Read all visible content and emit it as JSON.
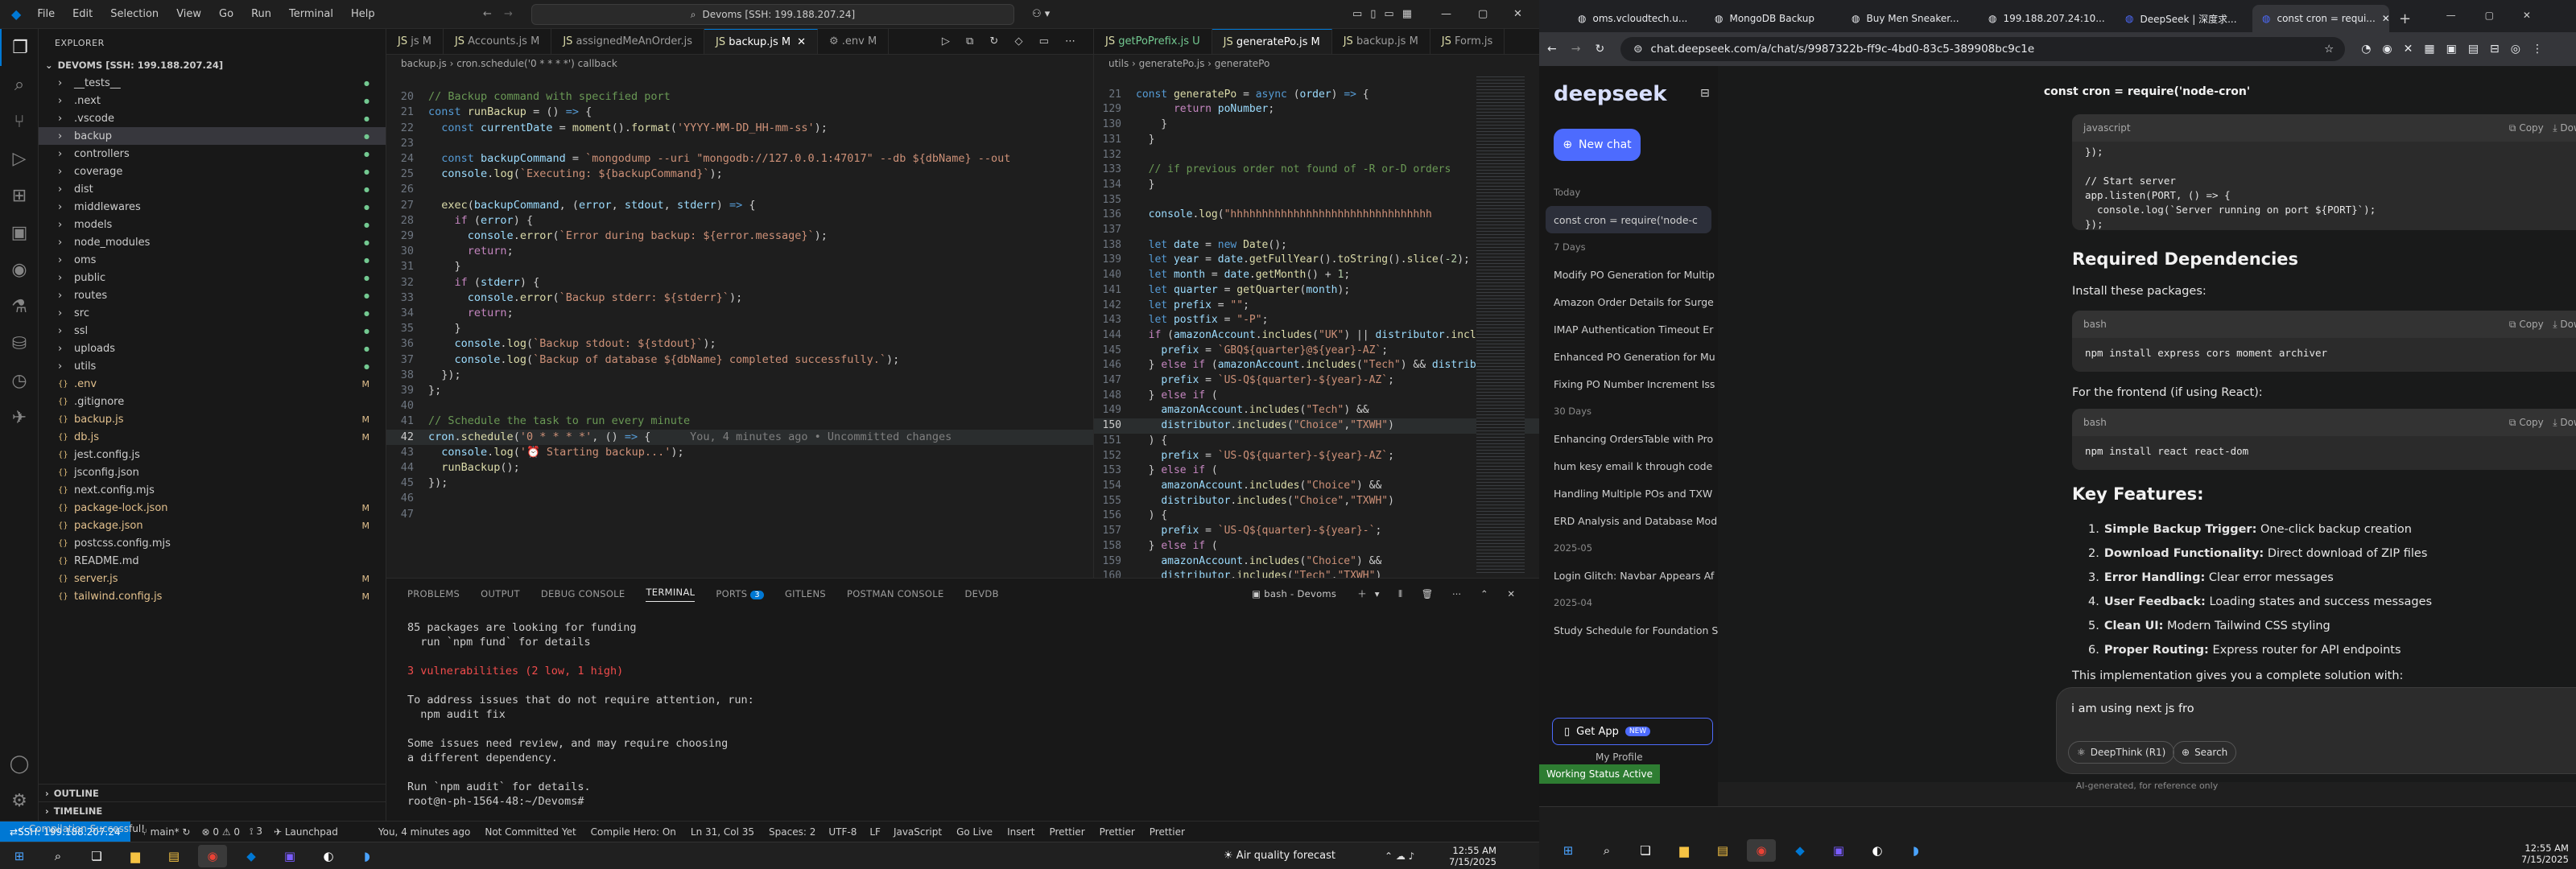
{
  "vscode": {
    "title": "Devoms [SSH: 199.188.207.24]",
    "menus": [
      "File",
      "Edit",
      "Selection",
      "View",
      "Go",
      "Run",
      "Terminal",
      "Help"
    ],
    "explorer": {
      "title": "EXPLORER",
      "root": "DEVOMS [SSH: 199.188.207.24]",
      "items": [
        {
          "name": "__tests__",
          "type": "folder",
          "badge": ""
        },
        {
          "name": ".next",
          "type": "folder",
          "badge": ""
        },
        {
          "name": ".vscode",
          "type": "folder",
          "badge": ""
        },
        {
          "name": "backup",
          "type": "folder",
          "badge": "",
          "selected": true
        },
        {
          "name": "controllers",
          "type": "folder",
          "badge": ""
        },
        {
          "name": "coverage",
          "type": "folder",
          "badge": ""
        },
        {
          "name": "dist",
          "type": "folder",
          "badge": ""
        },
        {
          "name": "middlewares",
          "type": "folder",
          "badge": ""
        },
        {
          "name": "models",
          "type": "folder",
          "badge": ""
        },
        {
          "name": "node_modules",
          "type": "folder",
          "badge": ""
        },
        {
          "name": "oms",
          "type": "folder",
          "badge": ""
        },
        {
          "name": "public",
          "type": "folder",
          "badge": ""
        },
        {
          "name": "routes",
          "type": "folder",
          "badge": ""
        },
        {
          "name": "src",
          "type": "folder",
          "badge": ""
        },
        {
          "name": "ssl",
          "type": "folder",
          "badge": ""
        },
        {
          "name": "uploads",
          "type": "folder",
          "badge": ""
        },
        {
          "name": "utils",
          "type": "folder",
          "badge": ""
        },
        {
          "name": ".env",
          "type": "file",
          "badge": "M"
        },
        {
          "name": ".gitignore",
          "type": "file",
          "badge": ""
        },
        {
          "name": "backup.js",
          "type": "file",
          "badge": "M"
        },
        {
          "name": "db.js",
          "type": "file",
          "badge": "M"
        },
        {
          "name": "jest.config.js",
          "type": "file",
          "badge": ""
        },
        {
          "name": "jsconfig.json",
          "type": "file",
          "badge": ""
        },
        {
          "name": "next.config.mjs",
          "type": "file",
          "badge": ""
        },
        {
          "name": "package-lock.json",
          "type": "file",
          "badge": "M"
        },
        {
          "name": "package.json",
          "type": "file",
          "badge": "M"
        },
        {
          "name": "postcss.config.mjs",
          "type": "file",
          "badge": ""
        },
        {
          "name": "README.md",
          "type": "file",
          "badge": ""
        },
        {
          "name": "server.js",
          "type": "file",
          "badge": "M"
        },
        {
          "name": "tailwind.config.js",
          "type": "file",
          "badge": "M"
        }
      ],
      "outline": "OUTLINE",
      "timeline": "TIMELINE"
    },
    "tabs_left": [
      "js M",
      "Accounts.js M",
      "assignedMeAnOrder.js",
      "backup.js M",
      ".env M"
    ],
    "tabs_right": [
      "getPoPrefix.js U",
      "generatePo.js M",
      "backup.js M",
      "Form.js"
    ],
    "breadcrumb_left": "backup.js › cron.schedule('0 * * * *') callback",
    "breadcrumb_right": "utils › generatePo.js › generatePo",
    "blame": "You, 4 minutes ago • Uncommitted changes",
    "panel_tabs": [
      "PROBLEMS",
      "OUTPUT",
      "DEBUG CONSOLE",
      "TERMINAL",
      "PORTS",
      "GITLENS",
      "POSTMAN CONSOLE",
      "DEVDB"
    ],
    "ports_badge": "3",
    "terminal_name": "bash - Devoms",
    "terminal_lines": [
      "85 packages are looking for funding",
      "  run `npm fund` for details",
      "",
      "3 vulnerabilities (2 low, 1 high)",
      "",
      "To address issues that do not require attention, run:",
      "  npm audit fix",
      "",
      "Some issues need review, and may require choosing",
      "a different dependency.",
      "",
      "Run `npm audit` for details.",
      "root@n-ph-1564-48:~/Devoms# "
    ],
    "status": {
      "remote": "SSH: 199.188.207.24",
      "branch": "main*",
      "errors": "0",
      "warnings": "0",
      "ports": "3",
      "launchpad": "Launchpad",
      "blame": "You, 4 minutes ago",
      "notcommitted": "Not Committed Yet",
      "compile": "Compile Hero: On",
      "position": "Ln 31, Col 35",
      "spaces": "Spaces: 2",
      "encoding": "UTF-8",
      "eol": "LF",
      "lang": "JavaScript",
      "golive": "Go Live",
      "insert": "Insert",
      "prettier": "Prettier",
      "message": "Compilation Successful!"
    }
  },
  "taskbar": {
    "weather": "Air quality forecast",
    "time": "12:55 AM",
    "date": "7/15/2025"
  },
  "browser": {
    "tabs": [
      "oms.vcloudtech.u...",
      "MongoDB Backup",
      "Buy Men Sneaker...",
      "199.188.207.24:10...",
      "DeepSeek | 深度求...",
      "const cron = requi..."
    ],
    "url": "chat.deepseek.com/a/chat/s/9987322b-ff9c-4bd0-83c5-389908bc9c1e",
    "page_title": "const cron = require('node-cron'",
    "logo": "deepseek",
    "new_chat": "New chat",
    "sidebar_groups": [
      {
        "label": "Today",
        "items": [
          "const cron = require('node-c"
        ]
      },
      {
        "label": "7 Days",
        "items": [
          "Modify PO Generation for Multip",
          "Amazon Order Details for Surge",
          "IMAP Authentication Timeout Er",
          "Enhanced PO Generation for Mu",
          "Fixing PO Number Increment Iss"
        ]
      },
      {
        "label": "30 Days",
        "items": [
          "Enhancing OrdersTable with Pro",
          "hum kesy email k through code",
          "Handling Multiple POs and TXW",
          "ERD Analysis and Database Mod"
        ]
      },
      {
        "label": "2025-05",
        "items": [
          "Login Glitch: Navbar Appears Af"
        ]
      },
      {
        "label": "2025-04",
        "items": [
          "Study Schedule for Foundation S"
        ]
      }
    ],
    "get_app": "Get App",
    "new_badge": "NEW",
    "my_profile": "My Profile",
    "code_block_1": {
      "lang": "javascript",
      "code": "});\n\n// Start server\napp.listen(PORT, () => {\n  console.log(`Server running on port ${PORT}`);\n});"
    },
    "copy": "Copy",
    "download": "Download",
    "h_required": "Required Dependencies",
    "p_install": "Install these packages:",
    "code_block_2": {
      "lang": "bash",
      "code": "npm install express cors moment archiver"
    },
    "p_frontend": "For the frontend (if using React):",
    "code_block_3": {
      "lang": "bash",
      "code": "npm install react react-dom"
    },
    "h_features": "Key Features:",
    "features": [
      {
        "num": "1.",
        "bold": "Simple Backup Trigger:",
        "text": " One-click backup creation"
      },
      {
        "num": "2.",
        "bold": "Download Functionality:",
        "text": " Direct download of ZIP files"
      },
      {
        "num": "3.",
        "bold": "Error Handling:",
        "text": " Clear error messages"
      },
      {
        "num": "4.",
        "bold": "User Feedback:",
        "text": " Loading states and success messages"
      },
      {
        "num": "5.",
        "bold": "Clean UI:",
        "text": " Modern Tailwind CSS styling"
      },
      {
        "num": "6.",
        "bold": "Proper Routing:",
        "text": " Express router for API endpoints"
      }
    ],
    "p_summary": "This implementation gives you a complete solution with:",
    "input_value": "i am using next js fro",
    "deepthink": "DeepThink (R1)",
    "search": "Search",
    "disclaimer": "AI-generated, for reference only",
    "working_status": "Working Status Active"
  }
}
